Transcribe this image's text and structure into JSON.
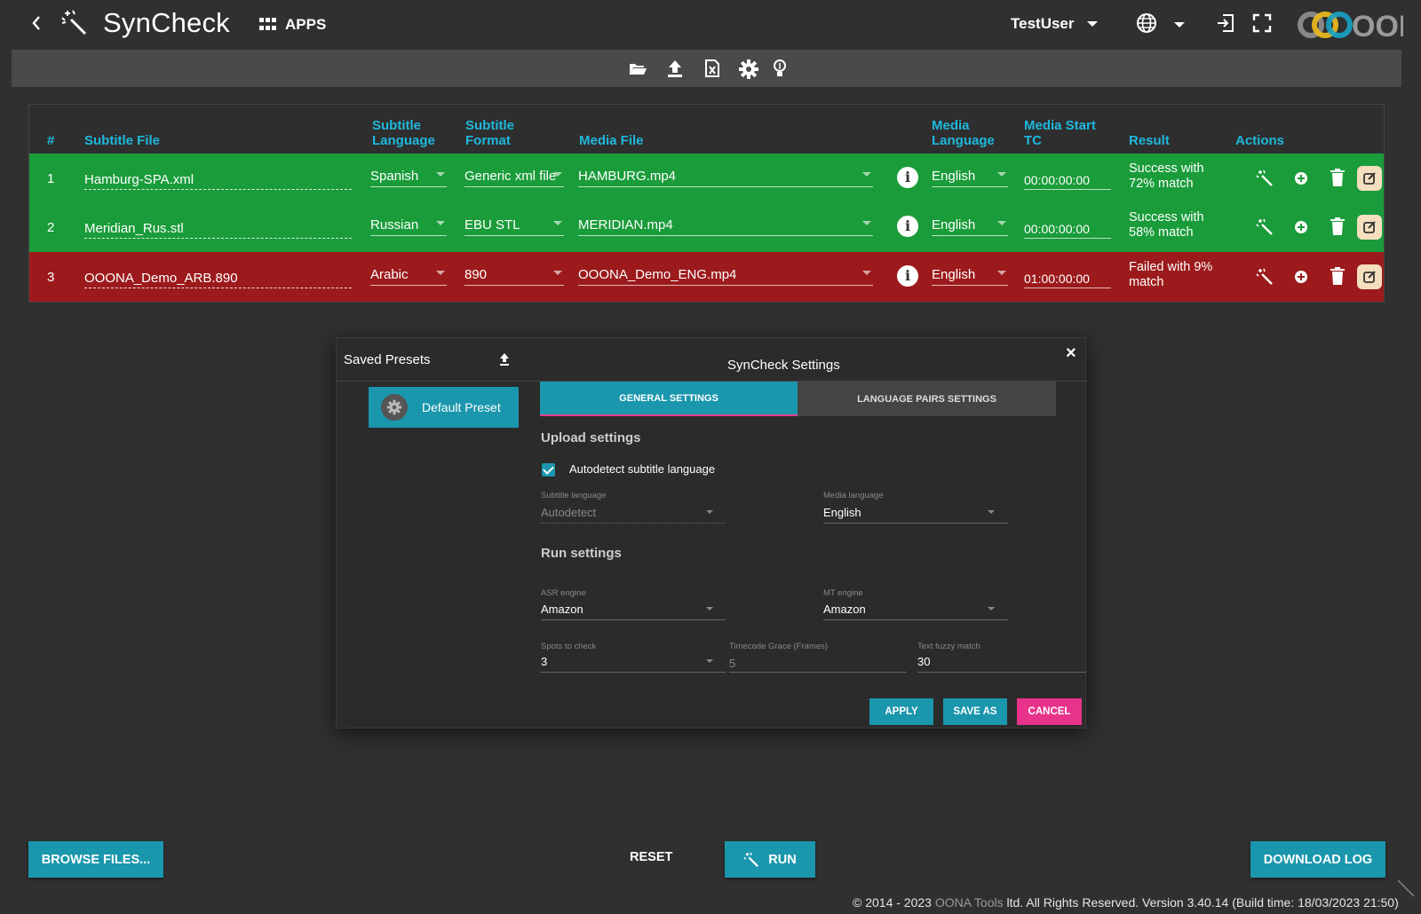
{
  "header": {
    "app_title": "SynCheck",
    "apps_label": "APPS",
    "user_name": "TestUser",
    "logo_text": "OONA"
  },
  "table": {
    "headers": {
      "num": "#",
      "subtitle_file": "Subtitle File",
      "subtitle_language": [
        "Subtitle",
        "Language"
      ],
      "subtitle_format": [
        "Subtitle",
        "Format"
      ],
      "media_file": "Media File",
      "media_language": [
        "Media",
        "Language"
      ],
      "media_start_tc": [
        "Media Start",
        "TC"
      ],
      "result": "Result",
      "actions": "Actions"
    },
    "rows": [
      {
        "num": "1",
        "status": "success",
        "subtitle_file": "Hamburg-SPA.xml",
        "subtitle_language": "Spanish",
        "subtitle_format": "Generic xml file",
        "media_file": "HAMBURG.mp4",
        "media_language": "English",
        "media_start_tc": "00:00:00:00",
        "result": [
          "Success with",
          "72% match"
        ]
      },
      {
        "num": "2",
        "status": "success",
        "subtitle_file": "Meridian_Rus.stl",
        "subtitle_language": "Russian",
        "subtitle_format": "EBU STL",
        "media_file": "MERIDIAN.mp4",
        "media_language": "English",
        "media_start_tc": "00:00:00:00",
        "result": [
          "Success with",
          "58% match"
        ]
      },
      {
        "num": "3",
        "status": "failed",
        "subtitle_file": "OOONA_Demo_ARB.890",
        "subtitle_language": "Arabic",
        "subtitle_format": "890",
        "media_file": "OOONA_Demo_ENG.mp4",
        "media_language": "English",
        "media_start_tc": "01:00:00:00",
        "result": [
          "Failed with 9%",
          "match"
        ]
      }
    ],
    "info_glyph": "i"
  },
  "modal": {
    "saved_presets_title": "Saved Presets",
    "title": "SynCheck Settings",
    "close_glyph": "×",
    "preset_name": "Default Preset",
    "tab_general": "GENERAL SETTINGS",
    "tab_pairs": "LANGUAGE PAIRS SETTINGS",
    "upload_settings": "Upload settings",
    "autodetect_label": "Autodetect subtitle language",
    "subtitle_language_label": "Subtitle language",
    "subtitle_language_value": "Autodetect",
    "media_language_label": "Media language",
    "media_language_value": "English",
    "run_settings": "Run settings",
    "asr_label": "ASR engine",
    "asr_value": "Amazon",
    "mt_label": "MT engine",
    "mt_value": "Amazon",
    "spots_label": "Spots to check",
    "spots_value": "3",
    "grace_label": "Timecode Grace (Frames)",
    "grace_value": "5",
    "fuzzy_label": "Text fuzzy match",
    "fuzzy_value": "30",
    "apply": "APPLY",
    "save_as": "SAVE AS",
    "cancel": "CANCEL"
  },
  "bottom": {
    "browse": "BROWSE FILES...",
    "reset": "RESET",
    "run": "RUN",
    "download_log": "DOWNLOAD LOG"
  },
  "footer": {
    "prefix": "© 2014 - 2023 ",
    "brand": "OONA Tools",
    "suffix": " ltd. All Rights Reserved. Version 3.40.14 (Build time: 18/03/2023 21:50)"
  },
  "colors": {
    "accent": "#1a96ad",
    "header_text": "#1fb8dc",
    "success_row": "#1a9c3a",
    "failed_row": "#9c1a1c",
    "cancel": "#e8338a"
  }
}
